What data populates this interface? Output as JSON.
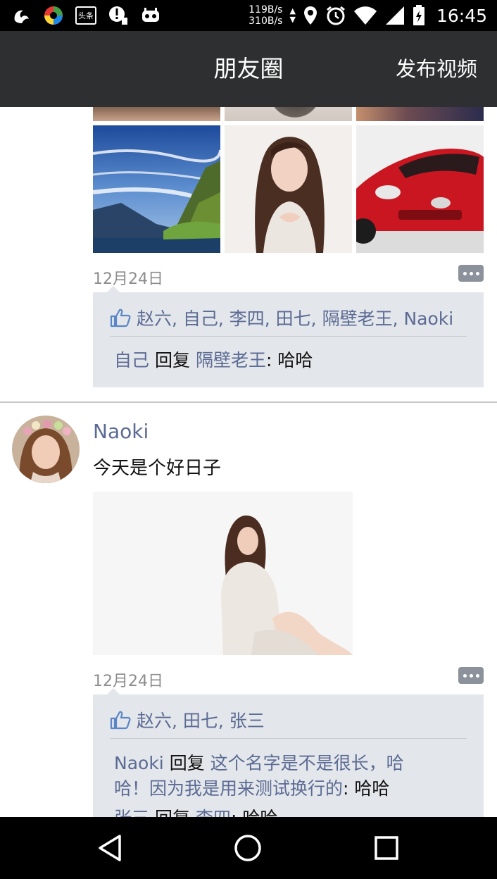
{
  "status_bar": {
    "net_up": "119B/s",
    "net_down": "310B/s",
    "clock": "16:45",
    "left_icons": [
      "uc-browser-icon",
      "color-app-icon",
      "toutiao-icon",
      "alert-icon",
      "bot-icon"
    ],
    "toutiao_text": "头条"
  },
  "header": {
    "title": "朋友圈",
    "action": "发布视频"
  },
  "posts": [
    {
      "time": "12月24日",
      "likes": "赵六, 自己, 李四, 田七, 隔壁老王, Naoki",
      "comments": [
        {
          "from": "自己",
          "reply_word": "回复",
          "to": "隔壁老王",
          "text": ": 哈哈"
        }
      ]
    },
    {
      "username": "Naoki",
      "text": "今天是个好日子",
      "time": "12月24日",
      "likes": "赵六, 田七, 张三",
      "comments": [
        {
          "from": "Naoki",
          "reply_word": "回复",
          "to": "这个名字是不是很长，哈哈！因为我是用来测试换行的",
          "text": ": 哈哈"
        },
        {
          "from": "张三",
          "reply_word": "回复",
          "to": "李四",
          "text": ": 哈哈"
        }
      ]
    }
  ],
  "colors": {
    "header_bg": "#2d2f30",
    "name_color": "#5b6b94",
    "panel_bg": "#e3e6ea",
    "time_color": "#8c8c8c"
  }
}
